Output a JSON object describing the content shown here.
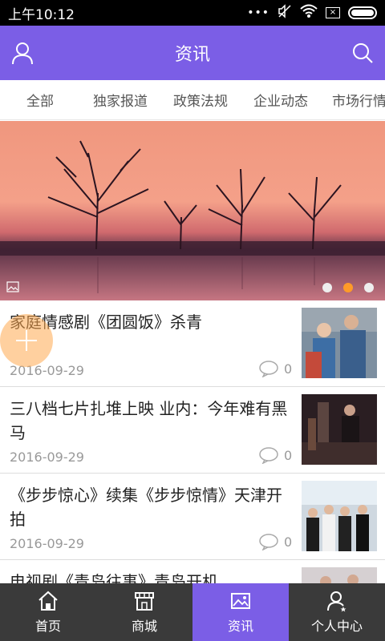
{
  "status_bar": {
    "time": "上午10:12",
    "notice_icon": "ellipsis-icon"
  },
  "app_bar": {
    "title": "资讯",
    "left_icon": "user-icon",
    "right_icon": "search-icon",
    "color": "#7b5ee6"
  },
  "tabs": [
    "全部",
    "独家报道",
    "政策法规",
    "企业动态",
    "市场行情"
  ],
  "banner": {
    "active_index": 1,
    "dot_count": 3,
    "accent": "#ff9b28"
  },
  "news": [
    {
      "title": "家庭情感剧《团圆饭》杀青",
      "date": "2016-09-29",
      "comments": "0"
    },
    {
      "title": "三八档七片扎堆上映 业内：今年难有黑马",
      "date": "2016-09-29",
      "comments": "0"
    },
    {
      "title": "《步步惊心》续集《步步惊情》天津开拍",
      "date": "2016-09-29",
      "comments": "0"
    },
    {
      "title": "电视剧《青岛往事》青岛开机",
      "date": "",
      "comments": ""
    }
  ],
  "bottom_nav": [
    {
      "label": "首页",
      "icon": "home-icon"
    },
    {
      "label": "商城",
      "icon": "store-icon"
    },
    {
      "label": "资讯",
      "icon": "news-icon",
      "active": true
    },
    {
      "label": "个人中心",
      "icon": "profile-icon"
    }
  ]
}
